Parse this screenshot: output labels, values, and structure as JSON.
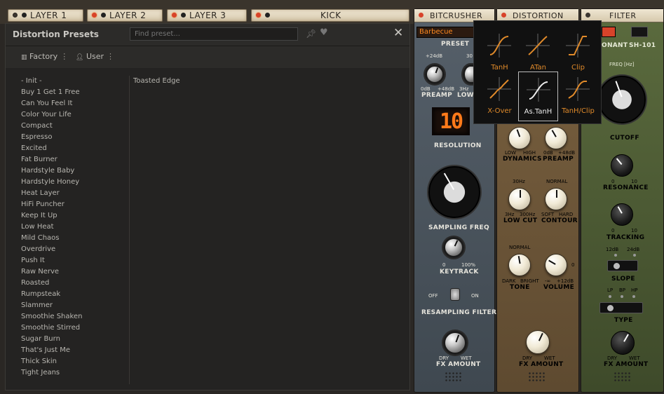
{
  "tabs": [
    {
      "label": "LAYER 1",
      "led": "off"
    },
    {
      "label": "LAYER 2",
      "led": "on"
    },
    {
      "label": "LAYER 3",
      "led": "on"
    },
    {
      "label": "KICK",
      "led": "on"
    }
  ],
  "presets_panel": {
    "title": "Distortion Presets",
    "search_placeholder": "Find preset...",
    "pin_icon": "pin-icon",
    "favorite_icon": "heart-icon",
    "close_icon": "close-icon",
    "factory_label": "Factory",
    "user_label": "User",
    "menu_glyph": "⋮",
    "items": [
      "- Init -",
      "Buy 1 Get 1 Free",
      "Can You Feel It",
      "Color Your Life",
      "Compact",
      "Espresso",
      "Excited",
      "Fat Burner",
      "Hardstyle Baby",
      "Hardstyle Honey",
      "Heat Layer",
      "HiFi Puncher",
      "Keep It Up",
      "Low Heat",
      "Mild Chaos",
      "Overdrive",
      "Push It",
      "Raw Nerve",
      "Roasted",
      "Rumpsteak",
      "Slammer",
      "Smoothie Shaken",
      "Smoothie Stirred",
      "Sugar Burn",
      "That's Just Me",
      "Thick Skin",
      "Tight Jeans"
    ],
    "selected_preset": "Toasted Edge"
  },
  "bitcrusher": {
    "title": "BITCRUSHER",
    "preset_value": "Barbecue",
    "preset_label": "PRESET",
    "preamp_range": "+24dB",
    "preamp_lo": "0dB",
    "preamp_hi": "+48dB",
    "preamp_label": "PREAMP",
    "lowcut_top": "30",
    "lowcut_lo": "3Hz",
    "lowcut_label": "LOW",
    "resolution_value": "10",
    "resolution_label": "RESOLUTION",
    "sampling_label": "SAMPLING FREQ",
    "keytrack_lo": "0",
    "keytrack_hi": "100%",
    "keytrack_label": "KEYTRACK",
    "resample_off": "OFF",
    "resample_on": "ON",
    "resample_label": "RESAMPLING FILTER",
    "fx_dry": "DRY",
    "fx_wet": "WET",
    "fx_label": "FX AMOUNT"
  },
  "distortion": {
    "title": "DISTORTION",
    "dyn_lo": "LOW",
    "dyn_hi": "HIGH",
    "dyn_label": "DYNAMICS",
    "pre_lo": "0dB",
    "pre_hi": "+48dB",
    "pre_label": "PREAMP",
    "lc_top": "30Hz",
    "lc_lo": "3Hz",
    "lc_hi": "300Hz",
    "lc_label": "LOW CUT",
    "ct_top": "NORMAL",
    "ct_lo": "SOFT",
    "ct_hi": "HARD",
    "ct_label": "CONTOUR",
    "tone_top": "NORMAL",
    "tone_lo": "DARK",
    "tone_hi": "BRIGHT",
    "tone_label": "TONE",
    "vol_lo": "-∞",
    "vol_hi": "+12dB",
    "vol_zero": "0",
    "vol_label": "VOLUME",
    "fx_dry": "DRY",
    "fx_wet": "WET",
    "fx_label": "FX AMOUNT"
  },
  "filter": {
    "title": "FILTER",
    "resonant": "ONANT",
    "sh101": "SH-101",
    "freq_label": "FREQ [Hz]",
    "cutoff_label": "CUTOFF",
    "res_lo": "0",
    "res_hi": "10",
    "res_label": "RESONANCE",
    "trk_lo": "0",
    "trk_hi": "10",
    "trk_label": "TRACKING",
    "slope_a": "12dB",
    "slope_b": "24dB",
    "slope_label": "SLOPE",
    "type_lp": "LP",
    "type_bp": "BP",
    "type_hp": "HP",
    "type_label": "TYPE",
    "fx_dry": "DRY",
    "fx_wet": "WET",
    "fx_label": "FX AMOUNT"
  },
  "shape_popup": {
    "options": [
      "TanH",
      "ATan",
      "Clip",
      "X-Over",
      "As.TanH",
      "TanH/Clip"
    ],
    "selected": "As.TanH"
  },
  "colors": {
    "accent_orange": "#e08a2a",
    "led_red": "#d8432a",
    "display_orange": "#ff7a1a"
  }
}
